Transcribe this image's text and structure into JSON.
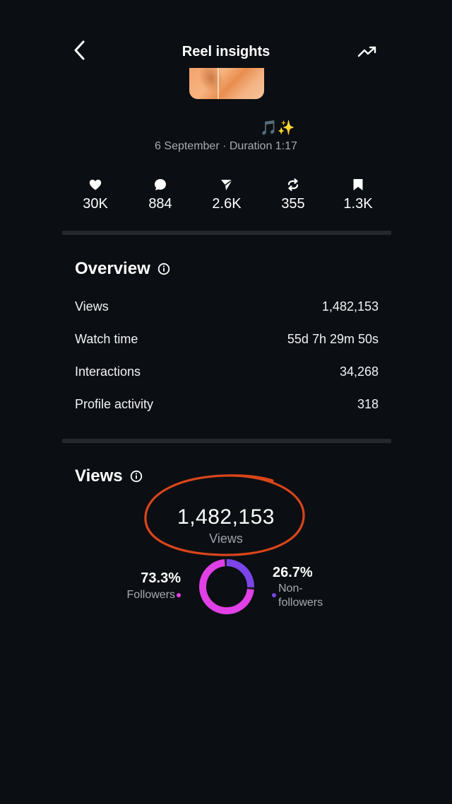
{
  "header": {
    "title": "Reel insights",
    "back_icon": "chevron-left-icon",
    "trend_icon": "trending-up-icon"
  },
  "reel": {
    "emoji": "🎵✨",
    "meta": "6 September · Duration 1:17"
  },
  "stats": [
    {
      "icon": "heart-icon",
      "value": "30K"
    },
    {
      "icon": "comment-icon",
      "value": "884"
    },
    {
      "icon": "send-icon",
      "value": "2.6K"
    },
    {
      "icon": "repost-icon",
      "value": "355"
    },
    {
      "icon": "bookmark-icon",
      "value": "1.3K"
    }
  ],
  "overview": {
    "title": "Overview",
    "rows": [
      {
        "label": "Views",
        "value": "1,482,153"
      },
      {
        "label": "Watch time",
        "value": "55d 7h 29m 50s"
      },
      {
        "label": "Interactions",
        "value": "34,268"
      },
      {
        "label": "Profile activity",
        "value": "318"
      }
    ]
  },
  "views": {
    "title": "Views",
    "total": "1,482,153",
    "total_label": "Views",
    "followers_pct": "73.3%",
    "followers_label": "Followers",
    "nonfollowers_pct": "26.7%",
    "nonfollowers_label_1": "Non-",
    "nonfollowers_label_2": "followers",
    "followers_fraction": 0.733,
    "nonfollowers_fraction": 0.267
  },
  "colors": {
    "background": "#0b0e12",
    "followers": "#e040e6",
    "nonfollowers": "#7b45e9",
    "annotation": "#d9451c"
  }
}
